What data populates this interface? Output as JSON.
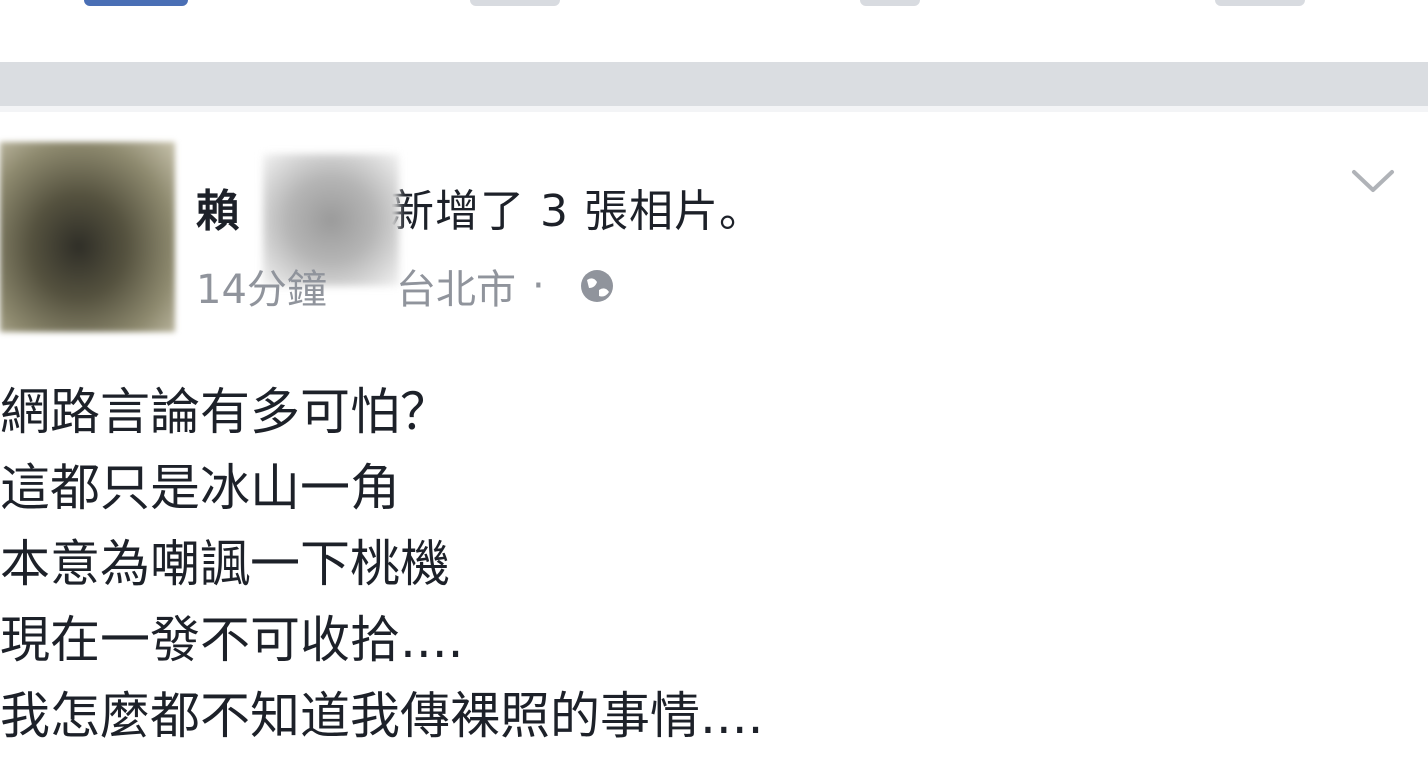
{
  "post": {
    "author": "賴",
    "action": "新增了 3 張相片。",
    "time": "14分鐘",
    "location": "台北市",
    "separator": "·",
    "lines": [
      "網路言論有多可怕？",
      "這都只是冰山一角",
      "本意為嘲諷一下桃機",
      "現在一發不可收拾....",
      "我怎麼都不知道我傳裸照的事情...."
    ]
  },
  "icons": {
    "privacy": "globe-icon",
    "menu": "chevron-down-icon"
  },
  "colors": {
    "text": "#1d2129",
    "meta": "#90949c",
    "divider": "#dadde1",
    "brand": "#4a6fb5"
  }
}
